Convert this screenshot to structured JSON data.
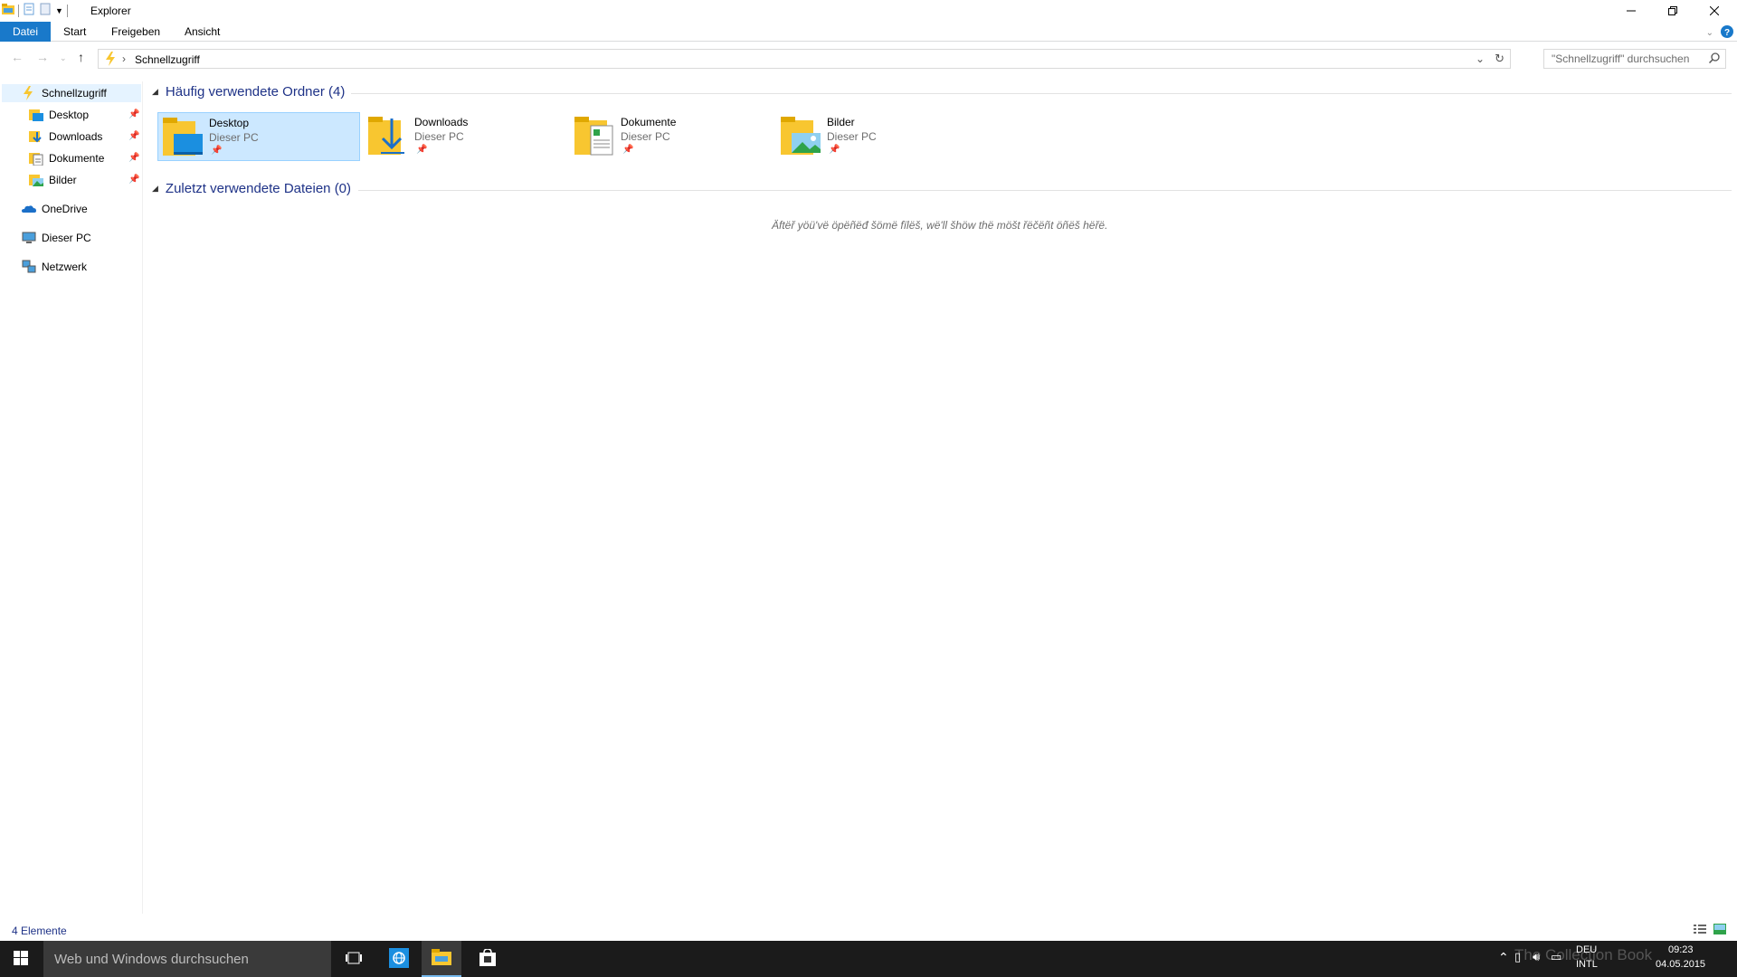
{
  "window": {
    "title": "Explorer"
  },
  "ribbon": {
    "tabs": [
      "Datei",
      "Start",
      "Freigeben",
      "Ansicht"
    ]
  },
  "address": {
    "breadcrumb": "Schnellzugriff",
    "search_placeholder": "\"Schnellzugriff\" durchsuchen"
  },
  "nav": {
    "quick_access": "Schnellzugriff",
    "pinned": [
      "Desktop",
      "Downloads",
      "Dokumente",
      "Bilder"
    ],
    "onedrive": "OneDrive",
    "this_pc": "Dieser PC",
    "network": "Netzwerk"
  },
  "main": {
    "frequent_header": "Häufig verwendete Ordner (4)",
    "recent_header": "Zuletzt verwendete Dateien (0)",
    "folders": [
      {
        "name": "Desktop",
        "location": "Dieser PC"
      },
      {
        "name": "Downloads",
        "location": "Dieser PC"
      },
      {
        "name": "Dokumente",
        "location": "Dieser PC"
      },
      {
        "name": "Bilder",
        "location": "Dieser PC"
      }
    ],
    "empty_message": "Äftëř yöü'vë öpëñëđ šömë fïlëš, wë'll šhöw thë möšt řëčëñt öñëš hëřë."
  },
  "status": {
    "item_count": "4 Elemente"
  },
  "taskbar": {
    "search_placeholder": "Web und Windows durchsuchen",
    "lang_top": "DEU",
    "lang_bottom": "INTL",
    "time": "09:23",
    "date": "04.05.2015",
    "watermark": "The Collection Book"
  },
  "colors": {
    "accent": "#1979ca",
    "selection": "#cce8ff",
    "header": "#1e3287",
    "folder": "#f8c630"
  }
}
